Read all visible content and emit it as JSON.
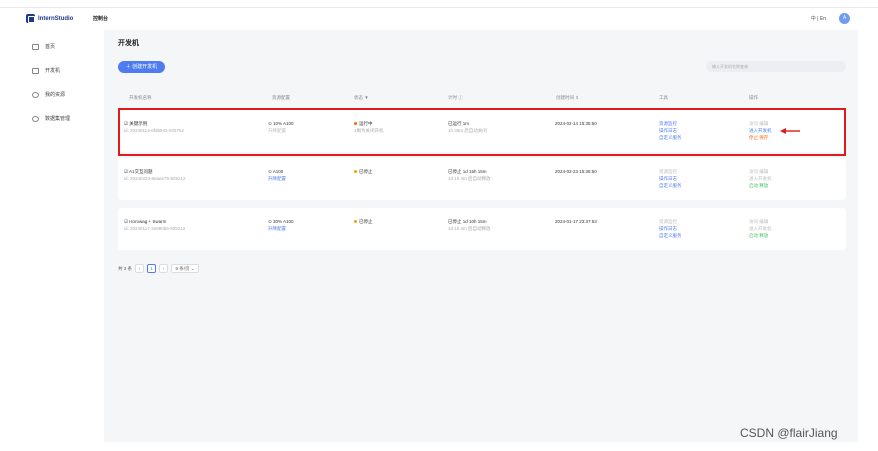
{
  "app": {
    "logo_text": "InternStudio",
    "top_crumb": "控制台",
    "lang": "中 | En",
    "avatar": "A"
  },
  "sidebar": {
    "items": [
      {
        "label": "首页",
        "icon": "home-icon"
      },
      {
        "label": "开发机",
        "icon": "monitor-icon"
      },
      {
        "label": "我的资源",
        "icon": "cloud-icon"
      },
      {
        "label": "数据集管理",
        "icon": "database-icon"
      }
    ]
  },
  "page": {
    "title": "开发机",
    "create_label": "＋ 创建开发机",
    "search_placeholder": "输入开发机名称查询"
  },
  "table": {
    "headers": [
      "开发机名称",
      "资源配置",
      "状态 ▼",
      "计时 ⓘ",
      "创建时间 ⇕",
      "工具",
      "操作"
    ],
    "rows": [
      {
        "name": "☑ 关键示例",
        "id": "id: 20240114-6fd6943-925752",
        "resource": "⊙ 10% A100",
        "resource_sub": "升降配置",
        "status": "运行中",
        "status_sub": "1剩为关闭开机",
        "status_color": "#ff6a00",
        "timer": "已运行 1m",
        "timer_sub": "1h 35m 后自动关闭",
        "created": "2024-02-14 15:35:50",
        "tools": [
          "资源监控",
          "操作日志",
          "自定义服务"
        ],
        "ops": [
          "访问 编辑",
          "进入开发机",
          "停止 保存"
        ]
      },
      {
        "name": "☑ A1交互问题",
        "id": "id: 20240223-8eaee75-925212",
        "resource": "⊙ A100",
        "resource_sub": "升降配置",
        "status": "已停止",
        "status_sub": "",
        "status_color": "#ff9d00",
        "timer": "已停止 1d 15h 15m",
        "timer_sub": "1d 1h 4m 后自动释放",
        "created": "2024-02-23 15:36:50",
        "tools": [
          "资源监控",
          "操作日志",
          "自定义服务"
        ],
        "ops": [
          "访问 编辑",
          "进入开发机",
          "启动 释放"
        ]
      },
      {
        "name": "☑ Horowag + Swarm",
        "id": "id: 20240117-2e890b5-925212",
        "resource": "⊙ 30% A100",
        "resource_sub": "升降配置",
        "status": "已停止",
        "status_sub": "",
        "status_color": "#ff9d00",
        "timer": "已停止 1d 10h 15m",
        "timer_sub": "1d 1h 4m 后自动释放",
        "created": "2024-01-17 23:37:53",
        "tools": [
          "资源监控",
          "操作日志",
          "自定义服务"
        ],
        "ops": [
          "访问 编辑",
          "进入开发机",
          "启动 释放"
        ]
      }
    ]
  },
  "pagination": {
    "total": "共 3 条",
    "prev": "‹",
    "current": "1",
    "next": "›",
    "size": "5 条/页 ⌄"
  },
  "watermark": "CSDN @flairJiang"
}
